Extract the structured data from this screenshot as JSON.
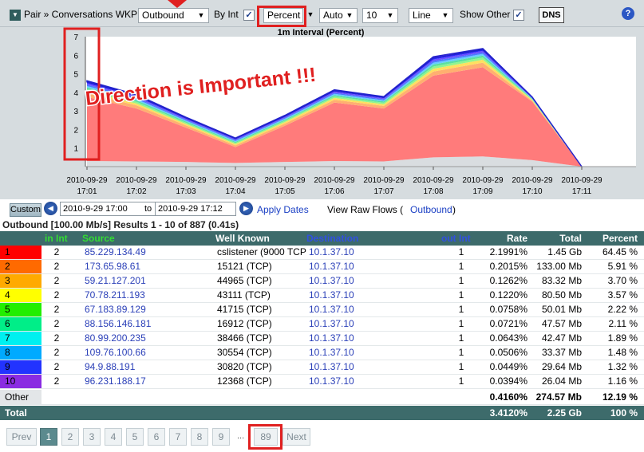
{
  "toolbar": {
    "breadcrumb": "Pair » Conversations WKP",
    "direction": "Outbound",
    "by_int_label": "By Int",
    "by_int_checked": "✓",
    "mode": "Percent",
    "interval": "Auto",
    "top_n": "10",
    "chart_style": "Line",
    "show_other_label": "Show Other",
    "show_other_checked": "✓",
    "dns_button": "DNS",
    "help_icon": "?"
  },
  "annotation": "Direction is Important !!!",
  "chart_data": {
    "type": "area",
    "title": "1m Interval (Percent)",
    "x": [
      "2010-09-29 17:01",
      "2010-09-29 17:02",
      "2010-09-29 17:03",
      "2010-09-29 17:04",
      "2010-09-29 17:05",
      "2010-09-29 17:06",
      "2010-09-29 17:07",
      "2010-09-29 17:08",
      "2010-09-29 17:09",
      "2010-09-29 17:10",
      "2010-09-29 17:11"
    ],
    "x_tick_labels": [
      [
        "2010-09-29",
        "17:01"
      ],
      [
        "2010-09-29",
        "17:02"
      ],
      [
        "2010-09-29",
        "17:03"
      ],
      [
        "2010-09-29",
        "17:04"
      ],
      [
        "2010-09-29",
        "17:05"
      ],
      [
        "2010-09-29",
        "17:06"
      ],
      [
        "2010-09-29",
        "17:07"
      ],
      [
        "2010-09-29",
        "17:08"
      ],
      [
        "2010-09-29",
        "17:09"
      ],
      [
        "2010-09-29",
        "17:10"
      ],
      [
        "2010-09-29",
        "17:11"
      ]
    ],
    "ylim": [
      0,
      7
    ],
    "y_ticks": [
      1,
      2,
      3,
      4,
      5,
      6,
      7
    ],
    "grid": false,
    "stacked": true,
    "series": [
      {
        "color": "#ff7b7b",
        "values": [
          3.45,
          2.85,
          1.85,
          0.85,
          1.95,
          3.15,
          2.85,
          4.4,
          4.8,
          3.15,
          0.0
        ]
      },
      {
        "color": "#ffb070",
        "values": [
          0.2,
          0.17,
          0.12,
          0.1,
          0.12,
          0.15,
          0.14,
          0.22,
          0.25,
          0.05,
          0.0
        ]
      },
      {
        "color": "#ffe060",
        "values": [
          0.12,
          0.1,
          0.08,
          0.07,
          0.08,
          0.1,
          0.09,
          0.15,
          0.16,
          0.04,
          0.0
        ]
      },
      {
        "color": "#8ff58f",
        "values": [
          0.1,
          0.09,
          0.07,
          0.06,
          0.07,
          0.08,
          0.08,
          0.12,
          0.12,
          0.03,
          0.0
        ]
      },
      {
        "color": "#5ae0a0",
        "values": [
          0.09,
          0.08,
          0.06,
          0.05,
          0.06,
          0.07,
          0.07,
          0.11,
          0.1,
          0.03,
          0.0
        ]
      },
      {
        "color": "#66ccff",
        "values": [
          0.08,
          0.07,
          0.05,
          0.05,
          0.05,
          0.07,
          0.06,
          0.1,
          0.09,
          0.02,
          0.0
        ]
      },
      {
        "color": "#4a7cff",
        "values": [
          0.08,
          0.07,
          0.05,
          0.05,
          0.05,
          0.06,
          0.06,
          0.09,
          0.08,
          0.02,
          0.0
        ]
      },
      {
        "color": "#6a4cff",
        "values": [
          0.07,
          0.06,
          0.05,
          0.04,
          0.05,
          0.06,
          0.05,
          0.08,
          0.08,
          0.02,
          0.0
        ]
      },
      {
        "color": "#2a2aff",
        "values": [
          0.07,
          0.06,
          0.04,
          0.04,
          0.04,
          0.05,
          0.05,
          0.08,
          0.07,
          0.02,
          0.0
        ]
      },
      {
        "color": "#9b30ff",
        "values": [
          0.06,
          0.05,
          0.04,
          0.03,
          0.04,
          0.05,
          0.04,
          0.07,
          0.06,
          0.01,
          0.0
        ]
      }
    ],
    "other": {
      "color": "#d9dde0",
      "values": [
        0.3,
        0.28,
        0.25,
        0.2,
        0.25,
        0.3,
        0.28,
        0.5,
        0.55,
        0.35,
        0.0
      ]
    }
  },
  "controls": {
    "custom_button": "Custom",
    "prev_icon": "◀",
    "start_date": "2010-9-29 17:00",
    "to_label": "to",
    "end_date": "2010-9-29 17:12",
    "next_icon": "▶",
    "apply_dates": "Apply Dates",
    "view_raw_flows": "View Raw Flows (",
    "raw_flows_link": "Outbound",
    "raw_flows_close": ")"
  },
  "results_title": "Outbound [100.00 Mb/s] Results 1 - 10 of 887 (0.41s)",
  "table": {
    "headers": {
      "in_int": "in Int",
      "source": "Source",
      "well_known": "Well Known",
      "destination": "Destination",
      "out_int": "out Int",
      "rate": "Rate",
      "total": "Total",
      "percent": "Percent"
    },
    "rows": [
      {
        "idx": "1",
        "color": "#ff0000",
        "in_int": "2",
        "source": "85.229.134.49",
        "well_known": "cslistener (9000 TCP",
        "destination": "10.1.37.10",
        "out_int": "1",
        "rate": "2.1991%",
        "total": "1.45 Gb",
        "percent": "64.45 %"
      },
      {
        "idx": "2",
        "color": "#ff6a00",
        "in_int": "2",
        "source": "173.65.98.61",
        "well_known": "15121 (TCP)",
        "destination": "10.1.37.10",
        "out_int": "1",
        "rate": "0.2015%",
        "total": "133.00 Mb",
        "percent": "5.91 %"
      },
      {
        "idx": "3",
        "color": "#ffaa00",
        "in_int": "2",
        "source": "59.21.127.201",
        "well_known": "44965 (TCP)",
        "destination": "10.1.37.10",
        "out_int": "1",
        "rate": "0.1262%",
        "total": "83.32 Mb",
        "percent": "3.70 %"
      },
      {
        "idx": "4",
        "color": "#ffff00",
        "in_int": "2",
        "source": "70.78.211.193",
        "well_known": "43111 (TCP)",
        "destination": "10.1.37.10",
        "out_int": "1",
        "rate": "0.1220%",
        "total": "80.50 Mb",
        "percent": "3.57 %"
      },
      {
        "idx": "5",
        "color": "#22ee00",
        "in_int": "2",
        "source": "67.183.89.129",
        "well_known": "41715 (TCP)",
        "destination": "10.1.37.10",
        "out_int": "1",
        "rate": "0.0758%",
        "total": "50.01 Mb",
        "percent": "2.22 %"
      },
      {
        "idx": "6",
        "color": "#00ee88",
        "in_int": "2",
        "source": "88.156.146.181",
        "well_known": "16912 (TCP)",
        "destination": "10.1.37.10",
        "out_int": "1",
        "rate": "0.0721%",
        "total": "47.57 Mb",
        "percent": "2.11 %"
      },
      {
        "idx": "7",
        "color": "#00f0f0",
        "in_int": "2",
        "source": "80.99.200.235",
        "well_known": "38466 (TCP)",
        "destination": "10.1.37.10",
        "out_int": "1",
        "rate": "0.0643%",
        "total": "42.47 Mb",
        "percent": "1.89 %"
      },
      {
        "idx": "8",
        "color": "#00aaff",
        "in_int": "2",
        "source": "109.76.100.66",
        "well_known": "30554 (TCP)",
        "destination": "10.1.37.10",
        "out_int": "1",
        "rate": "0.0506%",
        "total": "33.37 Mb",
        "percent": "1.48 %"
      },
      {
        "idx": "9",
        "color": "#2233ff",
        "in_int": "2",
        "source": "94.9.88.191",
        "well_known": "30820 (TCP)",
        "destination": "10.1.37.10",
        "out_int": "1",
        "rate": "0.0449%",
        "total": "29.64 Mb",
        "percent": "1.32 %"
      },
      {
        "idx": "10",
        "color": "#8a2be2",
        "in_int": "2",
        "source": "96.231.188.17",
        "well_known": "12368 (TCP)",
        "destination": "10.1.37.10",
        "out_int": "1",
        "rate": "0.0394%",
        "total": "26.04 Mb",
        "percent": "1.16 %"
      }
    ],
    "other": {
      "label": "Other",
      "rate": "0.4160%",
      "total": "274.57 Mb",
      "percent": "12.19 %"
    },
    "total": {
      "label": "Total",
      "rate": "3.4120%",
      "total": "2.25 Gb",
      "percent": "100 %"
    }
  },
  "pager": {
    "prev": "Prev",
    "pages": [
      "1",
      "2",
      "3",
      "4",
      "5",
      "6",
      "7",
      "8",
      "9"
    ],
    "ellipsis": "...",
    "last": "89",
    "next": "Next"
  }
}
